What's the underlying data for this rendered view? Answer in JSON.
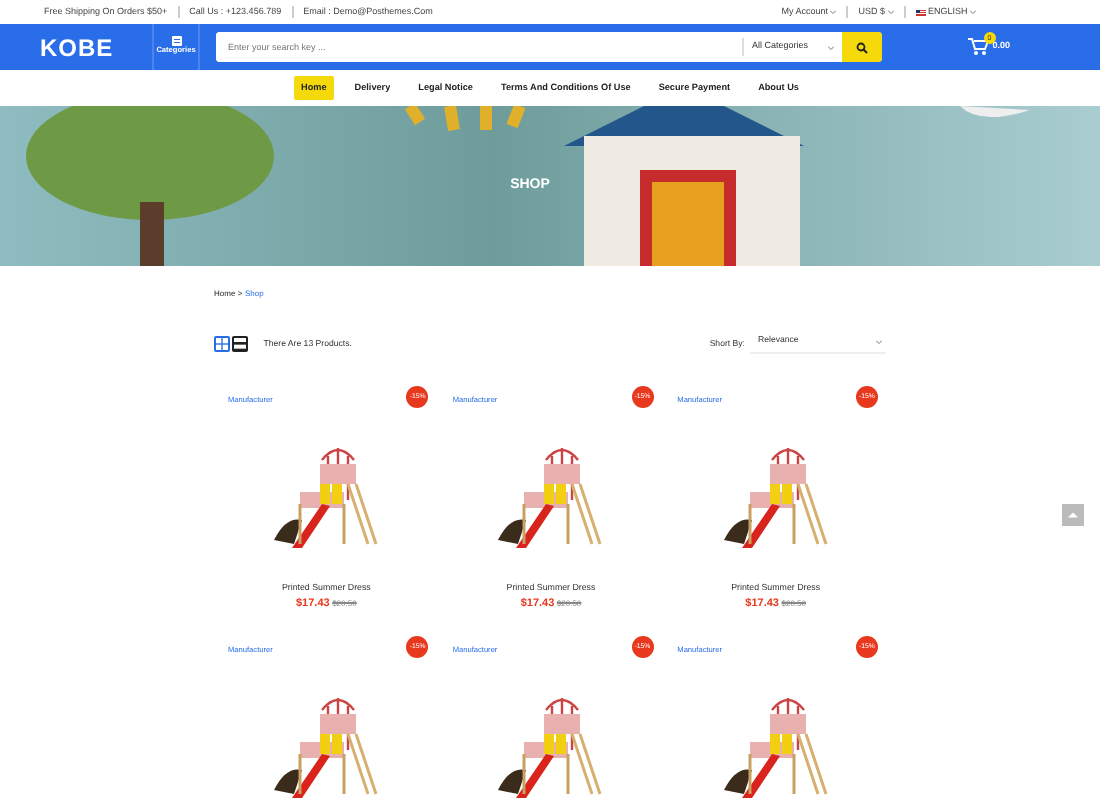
{
  "topbar": {
    "shipping": "Free Shipping On Orders $50+",
    "phone": "Call Us : +123.456.789",
    "email": "Email : Demo@Posthemes.Com",
    "account": "My Account",
    "currency": "USD $",
    "language": "ENGLISH"
  },
  "header": {
    "logo": "KOBE",
    "categories": "Categories",
    "search": {
      "placeholder": "Enter your search key ..."
    },
    "category_select": "All Categories",
    "cart_count": "0",
    "cart_total": "0.00"
  },
  "nav": [
    {
      "label": "Home",
      "selected": true
    },
    {
      "label": "Delivery",
      "selected": false
    },
    {
      "label": "Legal Notice",
      "selected": false
    },
    {
      "label": "Terms And Conditions Of Use",
      "selected": false
    },
    {
      "label": "Secure Payment",
      "selected": false
    },
    {
      "label": "About Us",
      "selected": false
    }
  ],
  "banner": {
    "title": "SHOP"
  },
  "breadcrumb": {
    "items": [
      {
        "label": "Home",
        "selected": false
      },
      {
        "label": "Shop",
        "selected": true
      }
    ],
    "separator": ">"
  },
  "toolbar": {
    "views": [
      {
        "kind": "grid",
        "selected": true
      },
      {
        "kind": "list",
        "selected": false
      }
    ],
    "count": "There Are 13 Products.",
    "sort_label": "Short By:",
    "sort_value": "Relevance"
  },
  "products": [
    {
      "manufacturer": "Manufacturer",
      "discount": "-15%",
      "name": "Printed Summer Dress",
      "price": "$17.43",
      "old_price": "$20.50"
    },
    {
      "manufacturer": "Manufacturer",
      "discount": "-15%",
      "name": "Printed Summer Dress",
      "price": "$17.43",
      "old_price": "$20.50"
    },
    {
      "manufacturer": "Manufacturer",
      "discount": "-15%",
      "name": "Printed Summer Dress",
      "price": "$17.43",
      "old_price": "$20.50"
    },
    {
      "manufacturer": "Manufacturer",
      "discount": "-15%"
    },
    {
      "manufacturer": "Manufacturer",
      "discount": "-15%"
    },
    {
      "manufacturer": "Manufacturer",
      "discount": "-15%"
    }
  ]
}
